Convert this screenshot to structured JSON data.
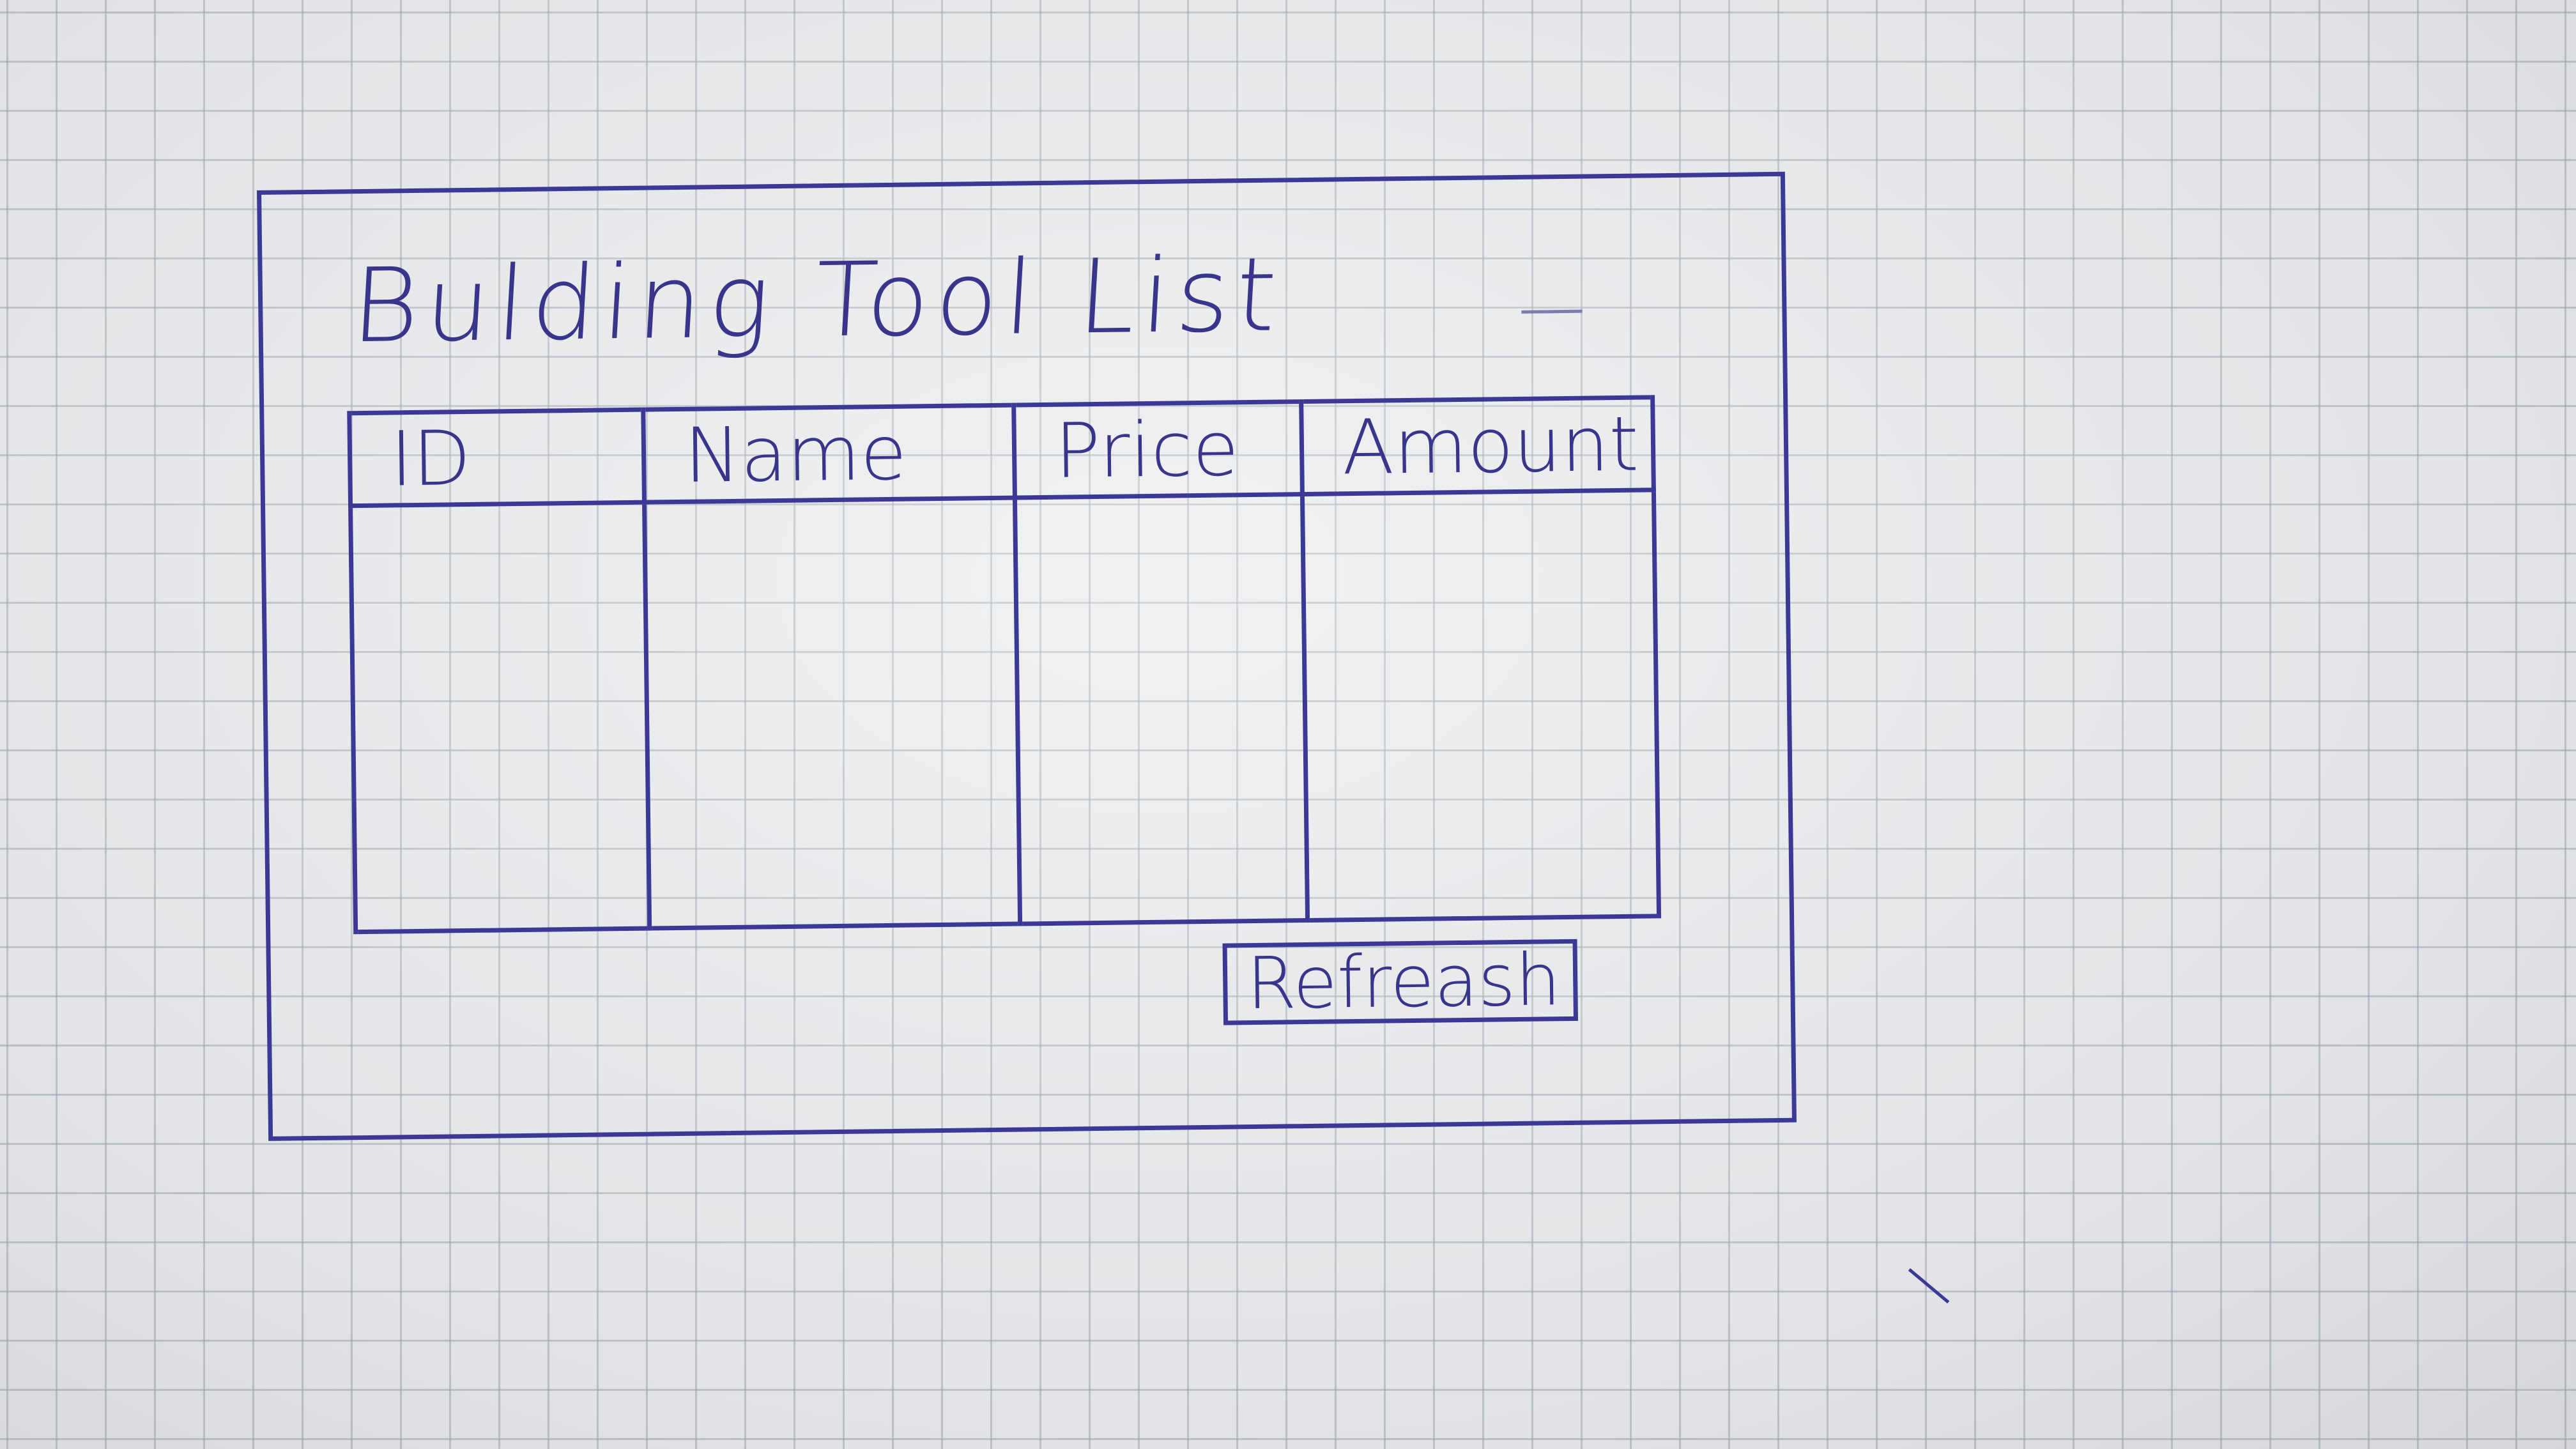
{
  "window": {
    "title": "Bulding Tool List"
  },
  "table": {
    "columns": [
      "ID",
      "Name",
      "Price",
      "Amount"
    ],
    "rows": []
  },
  "actions": {
    "refresh_label": "Refreash"
  },
  "colors": {
    "ink": "#3b3896",
    "paper": "#e9eaec",
    "grid": "#969eaa"
  }
}
